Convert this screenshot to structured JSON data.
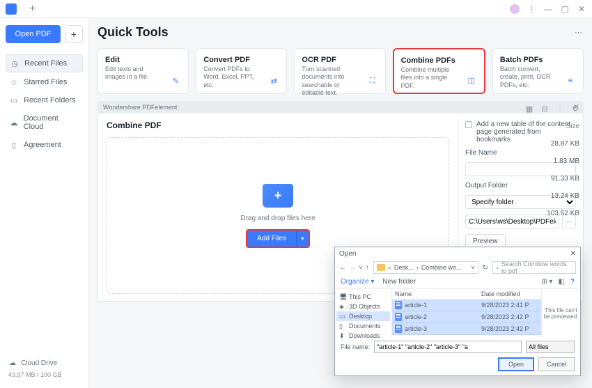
{
  "titlebar": {
    "app": "PDFelement"
  },
  "sidebar": {
    "open_pdf": "Open PDF",
    "plus": "+",
    "items": [
      {
        "icon": "clock-icon",
        "label": "Recent Files",
        "active": true
      },
      {
        "icon": "star-icon",
        "label": "Starred Files"
      },
      {
        "icon": "folder-icon",
        "label": "Recent Folders"
      },
      {
        "icon": "cloud-icon",
        "label": "Document Cloud"
      },
      {
        "icon": "file-icon",
        "label": "Agreement"
      }
    ],
    "cloud_drive": "Cloud Drive",
    "quota": "43.97 MB / 100 GB"
  },
  "header": {
    "title": "Quick Tools"
  },
  "tools": [
    {
      "title": "Edit",
      "sub": "Edit texts and images in a file."
    },
    {
      "title": "Convert PDF",
      "sub": "Convert PDFs to Word, Excel, PPT, etc."
    },
    {
      "title": "OCR PDF",
      "sub": "Turn scanned documents into searchable or editable text."
    },
    {
      "title": "Combine PDFs",
      "sub": "Combine multiple files into a single PDF.",
      "highlight": true
    },
    {
      "title": "Batch PDFs",
      "sub": "Batch convert, create, print, OCR PDFs, etc."
    }
  ],
  "modal": {
    "brand": "Wondershare PDFelement",
    "title": "Combine PDF",
    "drop_text": "Drag and drop files here",
    "add_files": "Add Files",
    "opt": {
      "toc": "Add a new table of the content page generated from bookmarks",
      "file_name_lbl": "File Name",
      "output_folder_lbl": "Output Folder",
      "specify_folder": "Specify folder",
      "folder_path": "C:\\Users\\ws\\Desktop\\PDFelement\\Com",
      "preview": "Preview"
    }
  },
  "sizes": {
    "header": "Size",
    "rows": [
      "28.87 KB",
      "1.83 MB",
      "91.33 KB",
      "13.24 KB",
      "103.52 KB"
    ]
  },
  "open_dialog": {
    "title": "Open",
    "path_segments": [
      "Desk...",
      "Combine wo..."
    ],
    "search_placeholder": "Search Combine words to pdf",
    "organize": "Organize",
    "new_folder": "New folder",
    "tree": [
      {
        "label": "This PC",
        "type": "pc"
      },
      {
        "label": "3D Objects",
        "type": "obj"
      },
      {
        "label": "Desktop",
        "type": "desktop",
        "selected": true
      },
      {
        "label": "Documents",
        "type": "docs"
      },
      {
        "label": "Downloads",
        "type": "dl"
      }
    ],
    "columns": {
      "name": "Name",
      "date": "Date modified"
    },
    "files": [
      {
        "name": "article-1",
        "date": "9/28/2023 2:41 P"
      },
      {
        "name": "article-2",
        "date": "9/28/2023 2:42 P"
      },
      {
        "name": "article-3",
        "date": "9/28/2023 2:42 P"
      }
    ],
    "preview_msg": "This file can't be previewed.",
    "file_name_lbl": "File name:",
    "file_name_value": "\"article-1\" \"article-2\" \"article-3\" \"a",
    "filter": "All files",
    "open_btn": "Open",
    "cancel_btn": "Cancel"
  }
}
